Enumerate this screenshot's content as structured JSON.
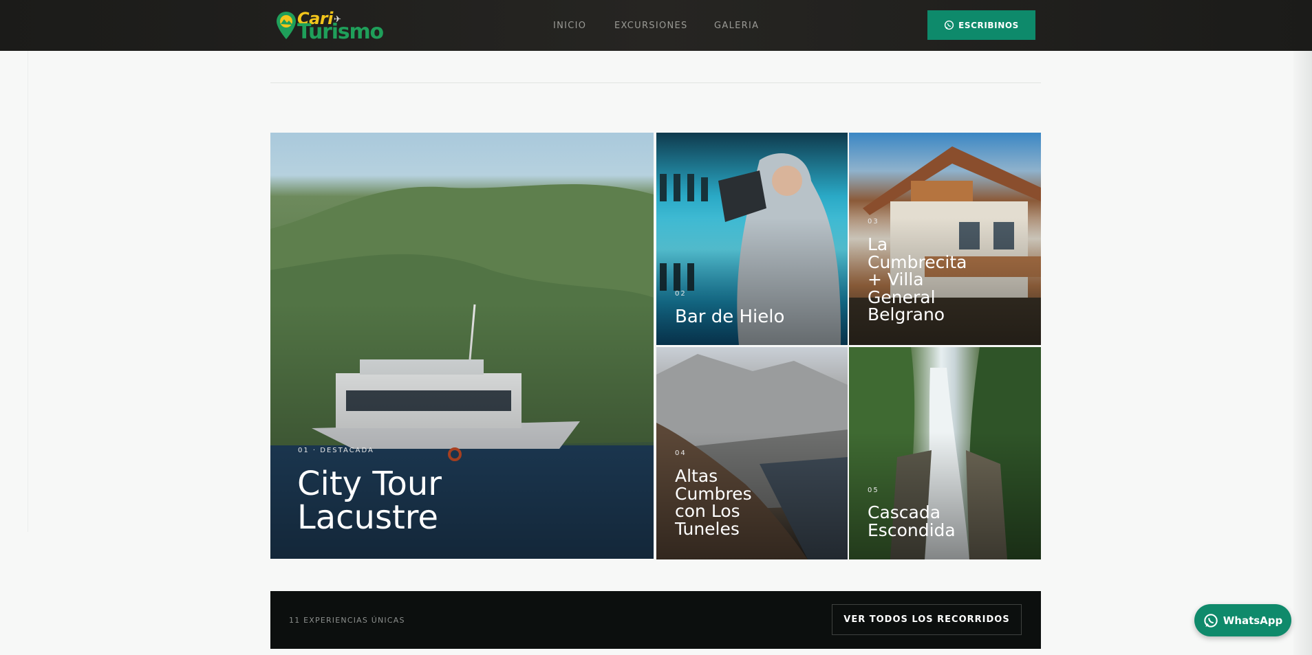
{
  "brand": {
    "line1": "Cari",
    "line2": "Turismo"
  },
  "nav": [
    "INICIO",
    "EXCURSIONES",
    "GALERIA"
  ],
  "header_button": "ESCRIBINOS",
  "tours": [
    {
      "number": "01 · DESTACADA",
      "title": "City Tour Lacustre"
    },
    {
      "number": "02",
      "title": "Bar de Hielo"
    },
    {
      "number": "03",
      "title": "La Cumbrecita + Villa General Belgrano"
    },
    {
      "number": "04",
      "title": "Altas Cumbres con Los Tuneles"
    },
    {
      "number": "05",
      "title": "Cascada Escondida"
    }
  ],
  "footer": {
    "count_label": "11 EXPERIENCIAS ÚNICAS",
    "view_all_button": "VER TODOS LOS RECORRIDOS"
  },
  "whatsapp_float": "WhatsApp",
  "colors": {
    "accent": "#0e8a6b",
    "header_bg": "#1f1f1d",
    "logo_yellow": "#f2c51b",
    "logo_green": "#1f9f5a"
  }
}
